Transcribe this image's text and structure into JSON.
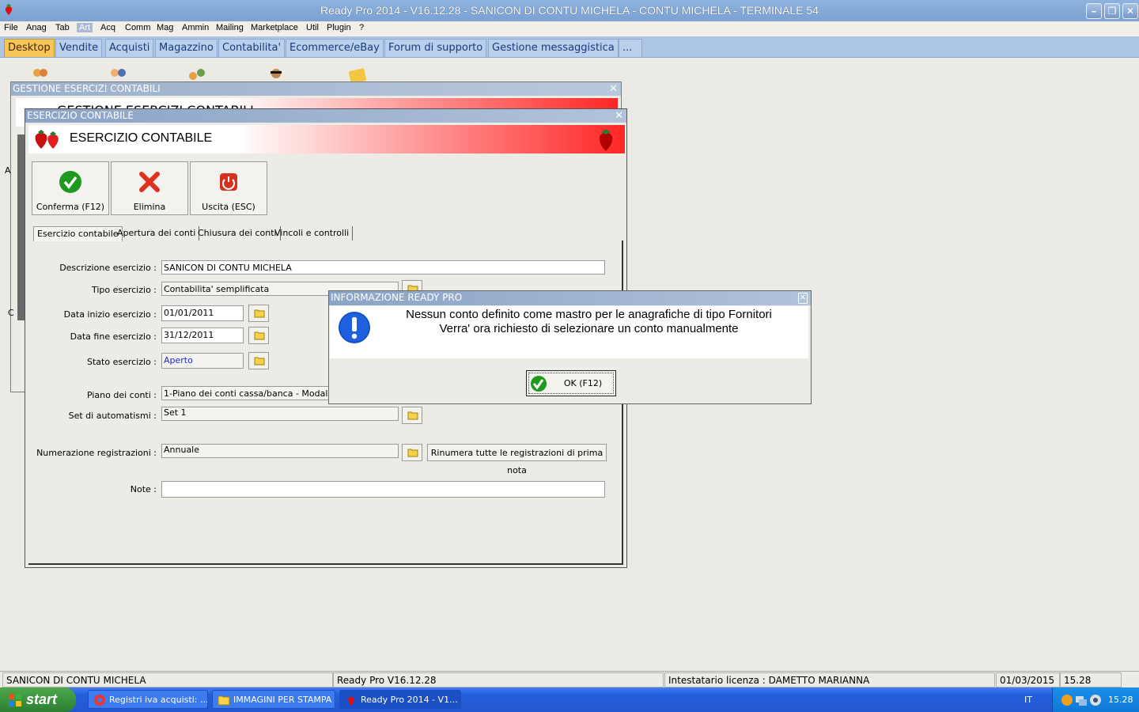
{
  "window": {
    "title": "Ready Pro 2014 - V16.12.28 - SANICON DI CONTU MICHELA - CONTU MICHELA - TERMINALE 54",
    "minimize": "–",
    "restore": "❐",
    "close": "✕"
  },
  "menu": [
    "File",
    "Anag",
    "Tab",
    "Art",
    "Acq",
    "Comm",
    "Mag",
    "Ammin",
    "Mailing",
    "Marketplace",
    "Util",
    "Plugin",
    "?"
  ],
  "main_tabs": [
    "Desktop",
    "Vendite",
    "Acquisti",
    "Magazzino",
    "Contabilita'",
    "Ecommerce/eBay",
    "Forum di supporto",
    "Gestione messaggistica",
    "..."
  ],
  "back_window": {
    "title": "GESTIONE ESERCIZI CONTABILI",
    "close": "✕",
    "banner_peek": "GESTIONE ESERCIZI CONTABILI",
    "side_letter_a": "A",
    "side_letter_c": "C"
  },
  "front_window": {
    "title": "ESERCIZIO CONTABILE",
    "close": "✕",
    "banner_title": "ESERCIZIO CONTABILE",
    "toolbar": {
      "confirm": "Conferma (F12)",
      "delete": "Elimina",
      "exit": "Uscita (ESC)"
    },
    "tabs": [
      "Esercizio contabile",
      "Apertura dei conti",
      "Chiusura dei conti",
      "Vincoli e controlli"
    ],
    "form": {
      "descrizione_label": "Descrizione esercizio :",
      "descrizione_value": "SANICON DI CONTU MICHELA",
      "tipo_label": "Tipo esercizio :",
      "tipo_value": "Contabilita' semplificata",
      "data_inizio_label": "Data inizio esercizio :",
      "data_inizio_value": "01/01/2011",
      "data_fine_label": "Data fine esercizio :",
      "data_fine_value": "31/12/2011",
      "stato_label": "Stato esercizio :",
      "stato_value": "Aperto",
      "piano_label": "Piano dei conti :",
      "piano_value": "1-Piano dei conti cassa/banca - Modalita' sen",
      "set_label": "Set di automatismi :",
      "set_value": "Set 1",
      "numerazione_label": "Numerazione registrazioni :",
      "numerazione_value": "Annuale",
      "rinumera_button": "Rinumera tutte le registrazioni di prima nota",
      "note_label": "Note :",
      "note_value": ""
    }
  },
  "dialog": {
    "title": "INFORMAZIONE READY PRO",
    "close": "✕",
    "line1": "Nessun conto definito come mastro per le anagrafiche di tipo Fornitori",
    "line2": "Verra' ora richiesto di selezionare un conto manualmente",
    "ok_button": "OK (F12)"
  },
  "status": {
    "company": "SANICON DI CONTU MICHELA",
    "version": "Ready Pro V16.12.28",
    "license": "Intestatario licenza : DAMETTO MARIANNA",
    "date": "01/03/2015",
    "time": "15.28"
  },
  "taskbar": {
    "start": "start",
    "items": [
      "Registri iva acquisti: ...",
      "IMMAGINI PER STAMPA",
      "Ready Pro 2014 - V1..."
    ],
    "language": "IT",
    "clock": "15.28"
  },
  "colors": {
    "title_bar": "#7aa1d2",
    "tab_selected": "#f7c659",
    "banner_red": "#ff2626",
    "taskbar": "#245edb",
    "start": "#37913b"
  }
}
